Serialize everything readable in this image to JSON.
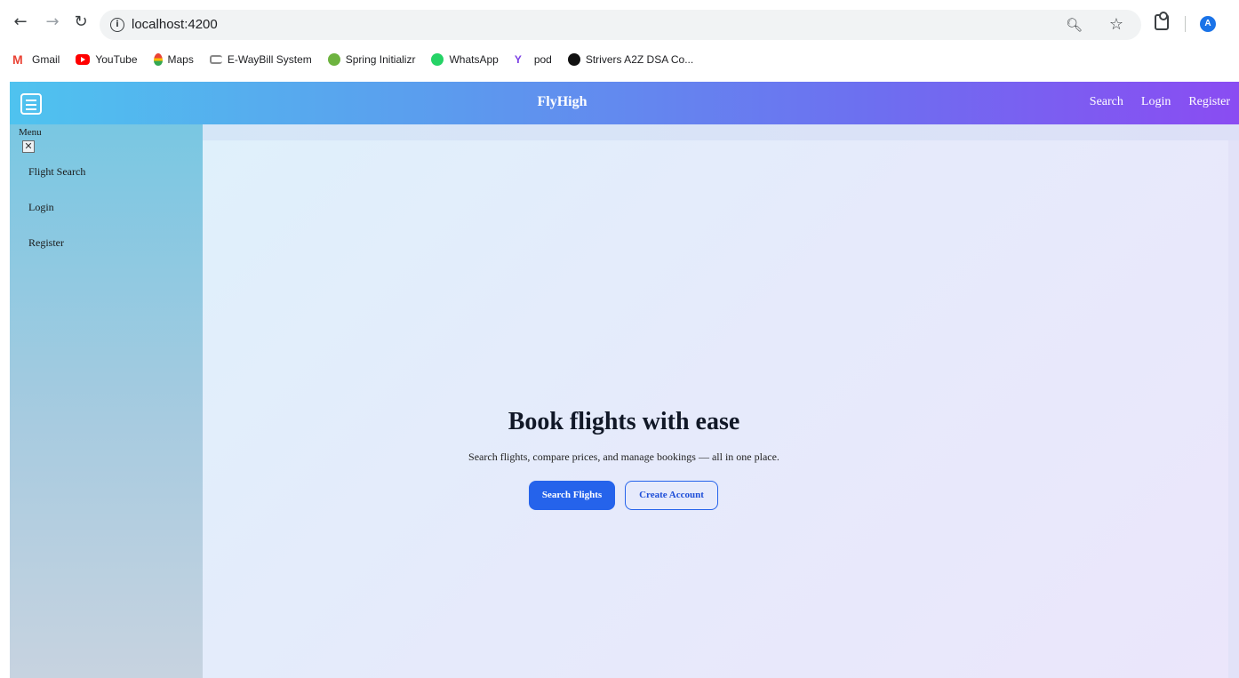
{
  "browser": {
    "url": "localhost:4200",
    "profile_initial": "A",
    "bookmarks": [
      {
        "label": "Gmail",
        "icon": "gmail-icon"
      },
      {
        "label": "YouTube",
        "icon": "youtube-icon"
      },
      {
        "label": "Maps",
        "icon": "maps-icon"
      },
      {
        "label": "E-WayBill System",
        "icon": "ewaybill-icon"
      },
      {
        "label": "Spring Initializr",
        "icon": "spring-icon"
      },
      {
        "label": "WhatsApp",
        "icon": "whatsapp-icon"
      },
      {
        "label": "pod",
        "icon": "pod-icon"
      },
      {
        "label": "Strivers A2Z DSA Co...",
        "icon": "tuf-icon"
      }
    ]
  },
  "header": {
    "brand": "FlyHigh",
    "links": [
      "Search",
      "Login",
      "Register"
    ],
    "colors": {
      "start": "#4fc3ef",
      "end": "#8a4cf2"
    }
  },
  "sidebar": {
    "title": "Menu",
    "close_symbol": "✕",
    "items": [
      "Flight Search",
      "Login",
      "Register"
    ]
  },
  "hero": {
    "title": "Book flights with ease",
    "subtitle": "Search flights, compare prices, and manage bookings — all in one place.",
    "primary_button": "Search Flights",
    "secondary_button": "Create Account",
    "accent_color": "#2563eb"
  }
}
